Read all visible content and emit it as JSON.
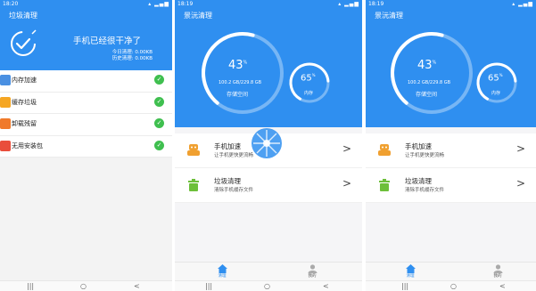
{
  "screen1": {
    "status_time": "18:20",
    "status_icons": "▴ ▂▄▆",
    "title": "垃圾清理",
    "headline": "手机已经很干净了",
    "today": "今日清理: 0.00KB",
    "history": "历史清理: 0.00KB",
    "items": [
      {
        "label": "内存加速",
        "color": "#4a90e2"
      },
      {
        "label": "缓存垃圾",
        "color": "#f5a623"
      },
      {
        "label": "卸载残留",
        "color": "#f07a2a"
      },
      {
        "label": "无用安装包",
        "color": "#e94e3c"
      }
    ],
    "check_glyph": "✓",
    "nav": [
      "|||",
      "○",
      "<"
    ]
  },
  "screen2": {
    "status_time": "18:19",
    "status_icons": "▴ ▂▄▆",
    "title": "景沅清理",
    "storage_percent": "43",
    "memory_percent": "65",
    "percent_sign": "%",
    "storage_detail": "100.2 GB/229.8 GB",
    "storage_label": "存储空间",
    "memory_label": "内存",
    "features": [
      {
        "title": "手机加速",
        "desc": "让手机更快更流畅"
      },
      {
        "title": "垃圾清理",
        "desc": "清除手机缓存文件"
      }
    ],
    "tabs": [
      "清理",
      "我的"
    ],
    "chevron": ">",
    "nav": [
      "|||",
      "○",
      "<"
    ]
  },
  "screen3": {
    "status_time": "18:19",
    "status_icons": "▴ ▂▄▆",
    "title": "景沅清理",
    "storage_percent": "43",
    "memory_percent": "65",
    "percent_sign": "%",
    "storage_detail": "100.2 GB/229.8 GB",
    "storage_label": "存储空间",
    "memory_label": "内存",
    "features": [
      {
        "title": "手机加速",
        "desc": "让手机更快更流畅"
      },
      {
        "title": "垃圾清理",
        "desc": "清除手机缓存文件"
      }
    ],
    "tabs": [
      "清理",
      "我的"
    ],
    "chevron": ">",
    "nav": [
      "|||",
      "○",
      "<"
    ]
  },
  "colors": {
    "brand_blue": "#2f8ff0",
    "success_green": "#3fbf4f",
    "accent_orange": "#f0a030",
    "clean_green": "#6dbf3a"
  },
  "icons": [
    "broom-clock-icon",
    "robot-icon",
    "trash-bin-icon",
    "home-icon",
    "user-icon",
    "chevron-right-icon",
    "check-icon"
  ]
}
